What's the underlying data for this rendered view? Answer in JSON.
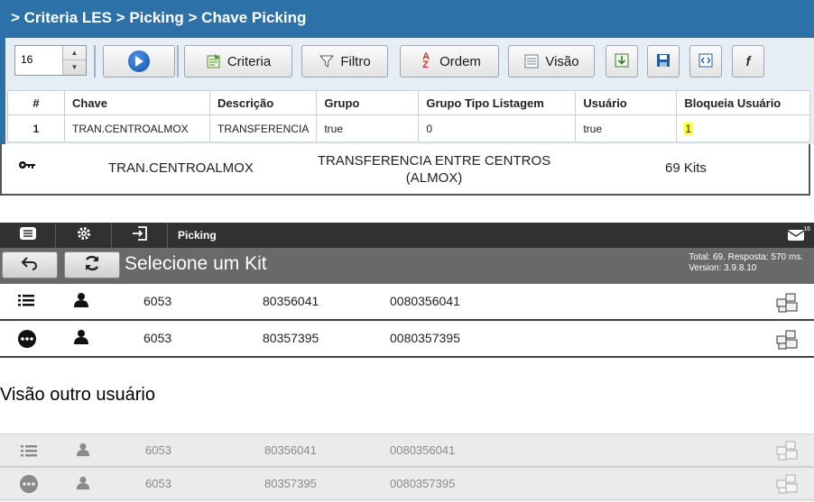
{
  "criteria": {
    "breadcrumb": "> Criteria LES > Picking > Chave Picking",
    "spinner_value": "16",
    "buttons": {
      "criteria": "Criteria",
      "filtro": "Filtro",
      "ordem": "Ordem",
      "visao": "Visão"
    },
    "columns": [
      "#",
      "Chave",
      "Descrição",
      "Grupo",
      "Grupo Tipo Listagem",
      "Usuário",
      "Bloqueia Usuário"
    ],
    "row": {
      "num": "1",
      "chave": "TRAN.CENTROALMOX",
      "descricao": "TRANSFERENCIA",
      "grupo": "true",
      "grupo_tipo": "0",
      "usuario": "true",
      "bloqueia": "1"
    }
  },
  "popup": {
    "chave": "TRAN.CENTROALMOX",
    "descricao_line1": "TRANSFERENCIA ENTRE CENTROS",
    "descricao_line2": "(ALMOX)",
    "kits": "69 Kits"
  },
  "mobile": {
    "tab_label": "Picking",
    "badge": "16",
    "title": "Selecione um Kit",
    "info_line1": "Total: 69. Resposta: 570 ms.",
    "info_line2": "Version: 3.9.8.10",
    "rows": [
      {
        "c1": "6053",
        "c2": "80356041",
        "c3": "0080356041"
      },
      {
        "c1": "6053",
        "c2": "80357395",
        "c3": "0080357395"
      }
    ]
  },
  "other_user_label": "Visão outro usuário",
  "other": {
    "rows": [
      {
        "c1": "6053",
        "c2": "80356041",
        "c3": "0080356041"
      },
      {
        "c1": "6053",
        "c2": "80357395",
        "c3": "0080357395"
      }
    ]
  }
}
